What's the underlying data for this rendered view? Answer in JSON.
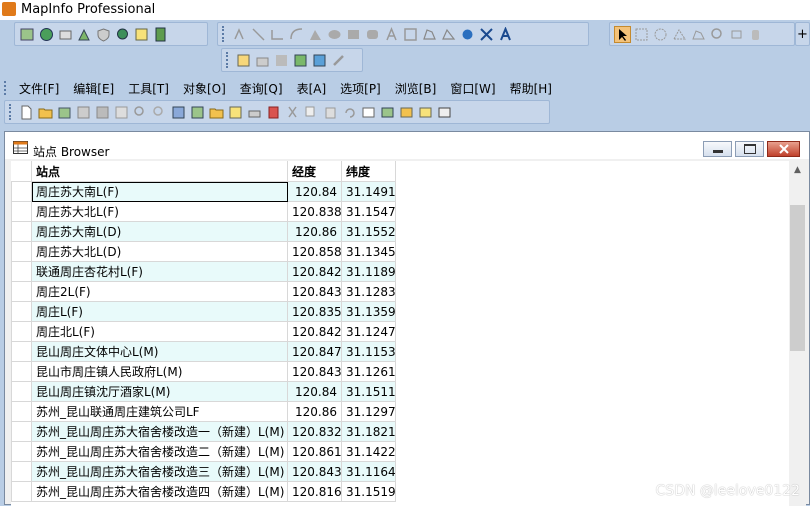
{
  "app": {
    "title": "MapInfo Professional"
  },
  "menu": [
    "文件[F]",
    "编辑[E]",
    "工具[T]",
    "对象[O]",
    "查询[Q]",
    "表[A]",
    "选项[P]",
    "浏览[B]",
    "窗口[W]",
    "帮助[H]"
  ],
  "browser": {
    "title": "站点 Browser",
    "columns": [
      "站点",
      "经度",
      "纬度"
    ],
    "rows": [
      [
        "周庄苏大南L(F)",
        "120.84",
        "31.1491"
      ],
      [
        "周庄苏大北L(F)",
        "120.838",
        "31.1547"
      ],
      [
        "周庄苏大南L(D)",
        "120.86",
        "31.1552"
      ],
      [
        "周庄苏大北L(D)",
        "120.858",
        "31.1345"
      ],
      [
        "联通周庄杏花村L(F)",
        "120.842",
        "31.1189"
      ],
      [
        "周庄2L(F)",
        "120.843",
        "31.1283"
      ],
      [
        "周庄L(F)",
        "120.835",
        "31.1359"
      ],
      [
        "周庄北L(F)",
        "120.842",
        "31.1247"
      ],
      [
        "昆山周庄文体中心L(M)",
        "120.847",
        "31.1153"
      ],
      [
        "昆山市周庄镇人民政府L(M)",
        "120.843",
        "31.1261"
      ],
      [
        "昆山周庄镇沈厅酒家L(M)",
        "120.84",
        "31.1511"
      ],
      [
        "苏州_昆山联通周庄建筑公司LF",
        "120.86",
        "31.1297"
      ],
      [
        "苏州_昆山周庄苏大宿舍楼改造一（新建）L(M)",
        "120.832",
        "31.1821"
      ],
      [
        "苏州_昆山周庄苏大宿舍楼改造二（新建）L(M)",
        "120.861",
        "31.1422"
      ],
      [
        "苏州_昆山周庄苏大宿舍楼改造三（新建）L(M)",
        "120.843",
        "31.1164"
      ],
      [
        "苏州_昆山周庄苏大宿舍楼改造四（新建）L(M)",
        "120.816",
        "31.1519"
      ]
    ]
  },
  "watermark": "CSDN @leelove0122"
}
